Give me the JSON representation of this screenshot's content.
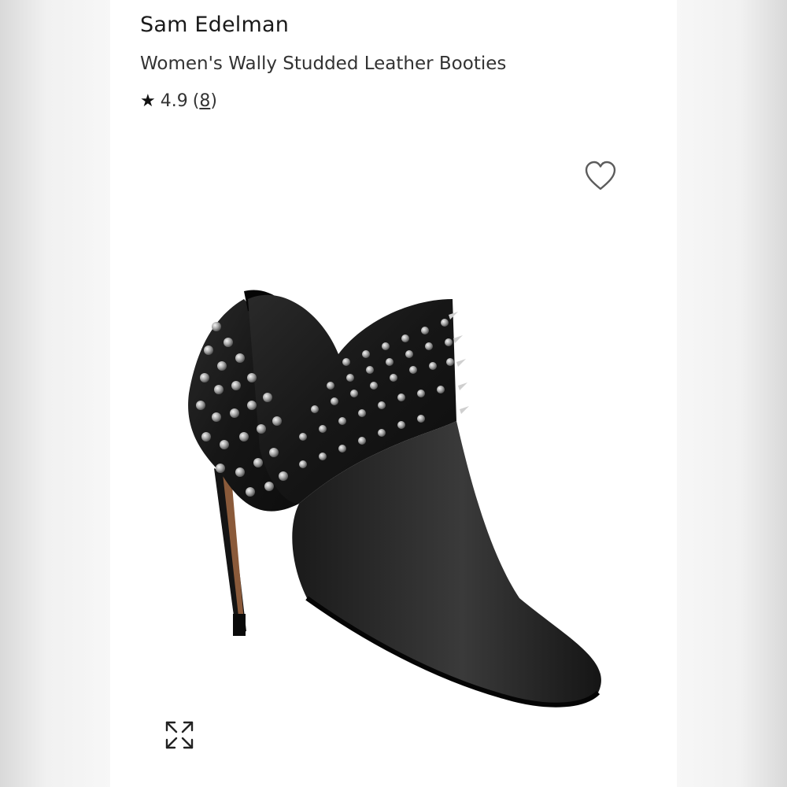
{
  "product": {
    "brand": "Sam Edelman",
    "name": "Women's Wally Studded Leather Booties",
    "rating_star": "★",
    "rating_value": "4.9",
    "review_count_open": "(",
    "review_count": "8",
    "review_count_close": ")"
  },
  "icons": {
    "favorite": "heart-outline-icon",
    "expand": "expand-arrows-icon"
  },
  "colors": {
    "background": "#ffffff",
    "text": "#1a1a1a",
    "bootie_leather": "#1b1b1b",
    "studs": "#c9c9c9",
    "heel_stripe": "#8a5a3a"
  }
}
